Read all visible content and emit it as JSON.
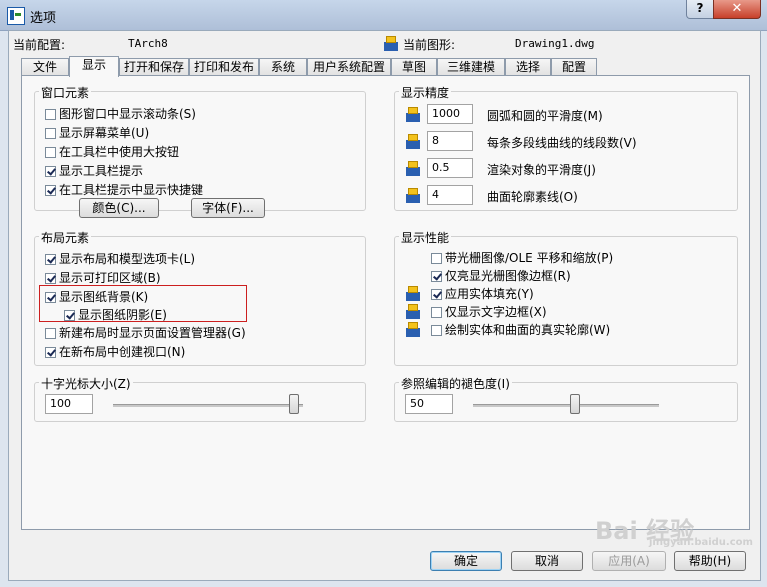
{
  "window": {
    "title": "选项",
    "help_glyph": "?",
    "close_glyph": "✕"
  },
  "header": {
    "current_profile_label": "当前配置:",
    "current_profile_value": "TArch8",
    "current_drawing_label": "当前图形:",
    "current_drawing_value": "Drawing1.dwg"
  },
  "tabs": [
    "文件",
    "显示",
    "打开和保存",
    "打印和发布",
    "系统",
    "用户系统配置",
    "草图",
    "三维建模",
    "选择",
    "配置"
  ],
  "window_elements": {
    "title": "窗口元素",
    "checkboxes": [
      {
        "label": "图形窗口中显示滚动条(S)",
        "checked": false
      },
      {
        "label": "显示屏幕菜单(U)",
        "checked": false
      },
      {
        "label": "在工具栏中使用大按钮",
        "checked": false
      },
      {
        "label": "显示工具栏提示",
        "checked": true
      },
      {
        "label": "在工具栏提示中显示快捷键",
        "checked": true
      }
    ],
    "colors_button": "颜色(C)...",
    "fonts_button": "字体(F)..."
  },
  "layout_elements": {
    "title": "布局元素",
    "checkboxes": [
      {
        "label": "显示布局和模型选项卡(L)",
        "checked": true
      },
      {
        "label": "显示可打印区域(B)",
        "checked": true
      },
      {
        "label": "显示图纸背景(K)",
        "checked": true
      },
      {
        "label": "显示图纸阴影(E)",
        "checked": true
      },
      {
        "label": "新建布局时显示页面设置管理器(G)",
        "checked": false
      },
      {
        "label": "在新布局中创建视口(N)",
        "checked": true
      }
    ]
  },
  "crosshair": {
    "title": "十字光标大小(Z)",
    "value": "100",
    "level": 0.95
  },
  "display_resolution": {
    "title": "显示精度",
    "fields": [
      {
        "value": "1000",
        "label": "圆弧和圆的平滑度(M)"
      },
      {
        "value": "8",
        "label": "每条多段线曲线的线段数(V)"
      },
      {
        "value": "0.5",
        "label": "渲染对象的平滑度(J)"
      },
      {
        "value": "4",
        "label": "曲面轮廓素线(O)"
      }
    ]
  },
  "display_performance": {
    "title": "显示性能",
    "checkboxes": [
      {
        "label": "带光栅图像/OLE 平移和缩放(P)",
        "checked": false,
        "icon": false
      },
      {
        "label": "仅亮显光栅图像边框(R)",
        "checked": true,
        "icon": false
      },
      {
        "label": "应用实体填充(Y)",
        "checked": true,
        "icon": true
      },
      {
        "label": "仅显示文字边框(X)",
        "checked": false,
        "icon": true
      },
      {
        "label": "绘制实体和曲面的真实轮廓(W)",
        "checked": false,
        "icon": true
      }
    ]
  },
  "xref_fade": {
    "title": "参照编辑的褪色度(I)",
    "value": "50",
    "level": 0.55
  },
  "footer": {
    "ok": "确定",
    "cancel": "取消",
    "apply": "应用(A)",
    "help": "帮助(H)"
  },
  "watermark": "Bai 经验",
  "watermark_url": "jingyan.baidu.com"
}
